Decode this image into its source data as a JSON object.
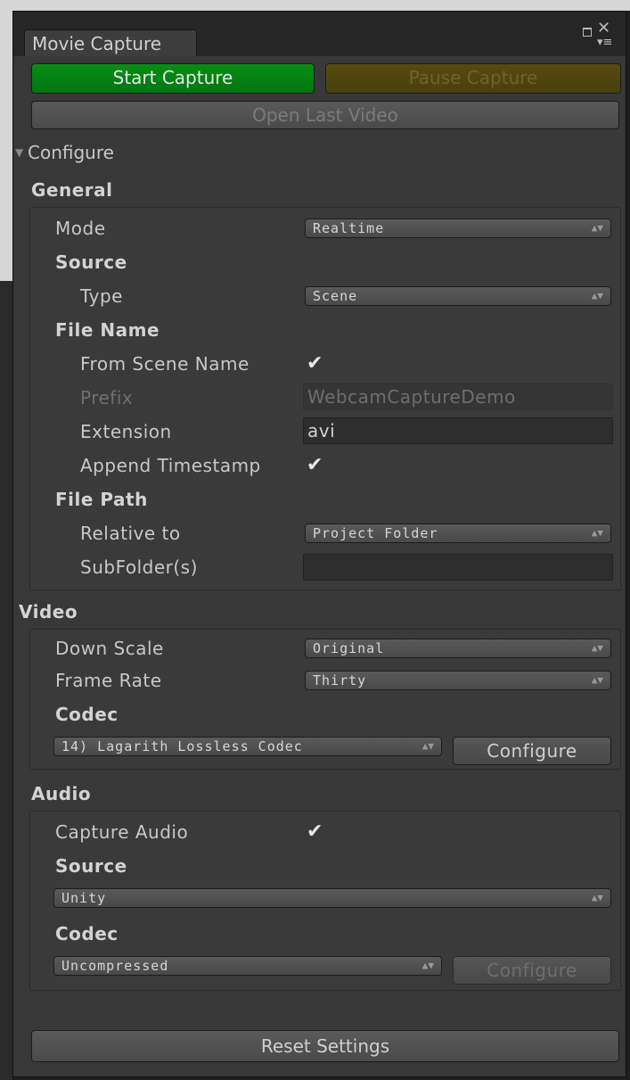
{
  "window": {
    "tab_title": "Movie Capture",
    "icons": {
      "maximize": "maximize-icon",
      "close": "close-icon",
      "menu": "panel-menu-icon"
    }
  },
  "actions": {
    "start": "Start Capture",
    "pause": "Pause Capture",
    "open_last": "Open Last Video",
    "reset": "Reset Settings"
  },
  "configure": {
    "label": "Configure",
    "expanded": true
  },
  "general": {
    "title": "General",
    "mode_label": "Mode",
    "mode_value": "Realtime",
    "source_header": "Source",
    "type_label": "Type",
    "type_value": "Scene",
    "file_name_header": "File Name",
    "from_scene_label": "From Scene Name",
    "from_scene_checked": true,
    "prefix_label": "Prefix",
    "prefix_value": "WebcamCaptureDemo",
    "extension_label": "Extension",
    "extension_value": "avi",
    "append_timestamp_label": "Append Timestamp",
    "append_timestamp_checked": true,
    "file_path_header": "File Path",
    "relative_to_label": "Relative to",
    "relative_to_value": "Project Folder",
    "subfolder_label": "SubFolder(s)",
    "subfolder_value": ""
  },
  "video": {
    "title": "Video",
    "down_scale_label": "Down Scale",
    "down_scale_value": "Original",
    "frame_rate_label": "Frame Rate",
    "frame_rate_value": "Thirty",
    "codec_header": "Codec",
    "codec_value": "14) Lagarith Lossless Codec",
    "configure_button": "Configure"
  },
  "audio": {
    "title": "Audio",
    "capture_audio_label": "Capture Audio",
    "capture_audio_checked": true,
    "source_header": "Source",
    "source_value": "Unity",
    "codec_header": "Codec",
    "codec_value": "Uncompressed",
    "configure_button": "Configure"
  },
  "colors": {
    "start_button": "#0a8d16",
    "pause_button": "#574a12",
    "panel_bg": "#383838"
  }
}
